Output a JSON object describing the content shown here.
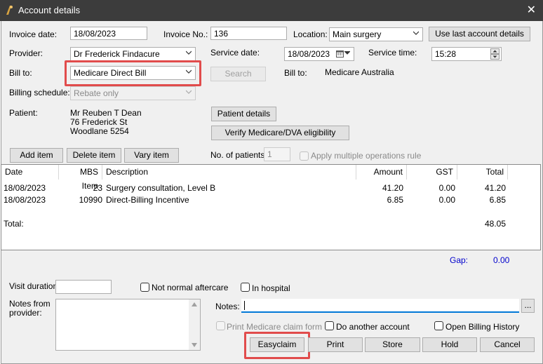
{
  "window": {
    "title": "Account details"
  },
  "form": {
    "invoice_date_label": "Invoice date:",
    "invoice_date": "18/08/2023",
    "invoice_no_label": "Invoice No.:",
    "invoice_no": "136",
    "location_label": "Location:",
    "location": "Main surgery",
    "use_last_button": "Use last account details",
    "provider_label": "Provider:",
    "provider": "Dr Frederick Findacure",
    "service_date_label": "Service date:",
    "service_date": "18/08/2023",
    "service_time_label": "Service time:",
    "service_time": "15:28",
    "bill_to_label": "Bill to:",
    "bill_to": "Medicare Direct Bill",
    "search_button": "Search",
    "bill_to_right_label": "Bill to:",
    "bill_to_right_value": "Medicare Australia",
    "billing_schedule_label": "Billing schedule:",
    "billing_schedule": "Rebate only",
    "patient_label": "Patient:",
    "patient_name": "Mr Reuben T Dean",
    "patient_street": "76 Frederick St",
    "patient_suburb": "Woodlane  5254",
    "patient_details_button": "Patient details",
    "verify_button": "Verify Medicare/DVA eligibility",
    "add_item_button": "Add item",
    "delete_item_button": "Delete item",
    "vary_item_button": "Vary item",
    "no_patients_label": "No. of patients:",
    "no_patients": "1",
    "apply_multiple_label": "Apply multiple operations rule"
  },
  "table": {
    "headers": [
      "Date",
      "MBS Item",
      "Description",
      "Amount",
      "GST",
      "Total"
    ],
    "rows": [
      [
        "18/08/2023",
        "23",
        "Surgery consultation, Level B",
        "41.20",
        "0.00",
        "41.20"
      ],
      [
        "18/08/2023",
        "10990",
        "Direct-Billing Incentive",
        "6.85",
        "0.00",
        "6.85"
      ]
    ],
    "total_label": "Total:",
    "total_value": "48.05"
  },
  "gap": {
    "label": "Gap:",
    "value": "0.00",
    "color": "#0000cc"
  },
  "bottom": {
    "visit_duration_label": "Visit duration:",
    "not_normal_aftercare": "Not normal aftercare",
    "in_hospital": "In hospital",
    "notes_from_provider_label": "Notes from provider:",
    "notes_label": "Notes:",
    "notes_more": "...",
    "print_medicare_claim": "Print Medicare claim form",
    "do_another_account": "Do another account",
    "open_billing_history": "Open Billing History",
    "easyclaim_button": "Easyclaim",
    "print_button": "Print",
    "store_button": "Store",
    "hold_button": "Hold",
    "cancel_button": "Cancel"
  },
  "colors": {
    "highlight": "#e14c4c",
    "titlebar": "#3c3c3c",
    "window_bg": "#f0f0f0"
  }
}
